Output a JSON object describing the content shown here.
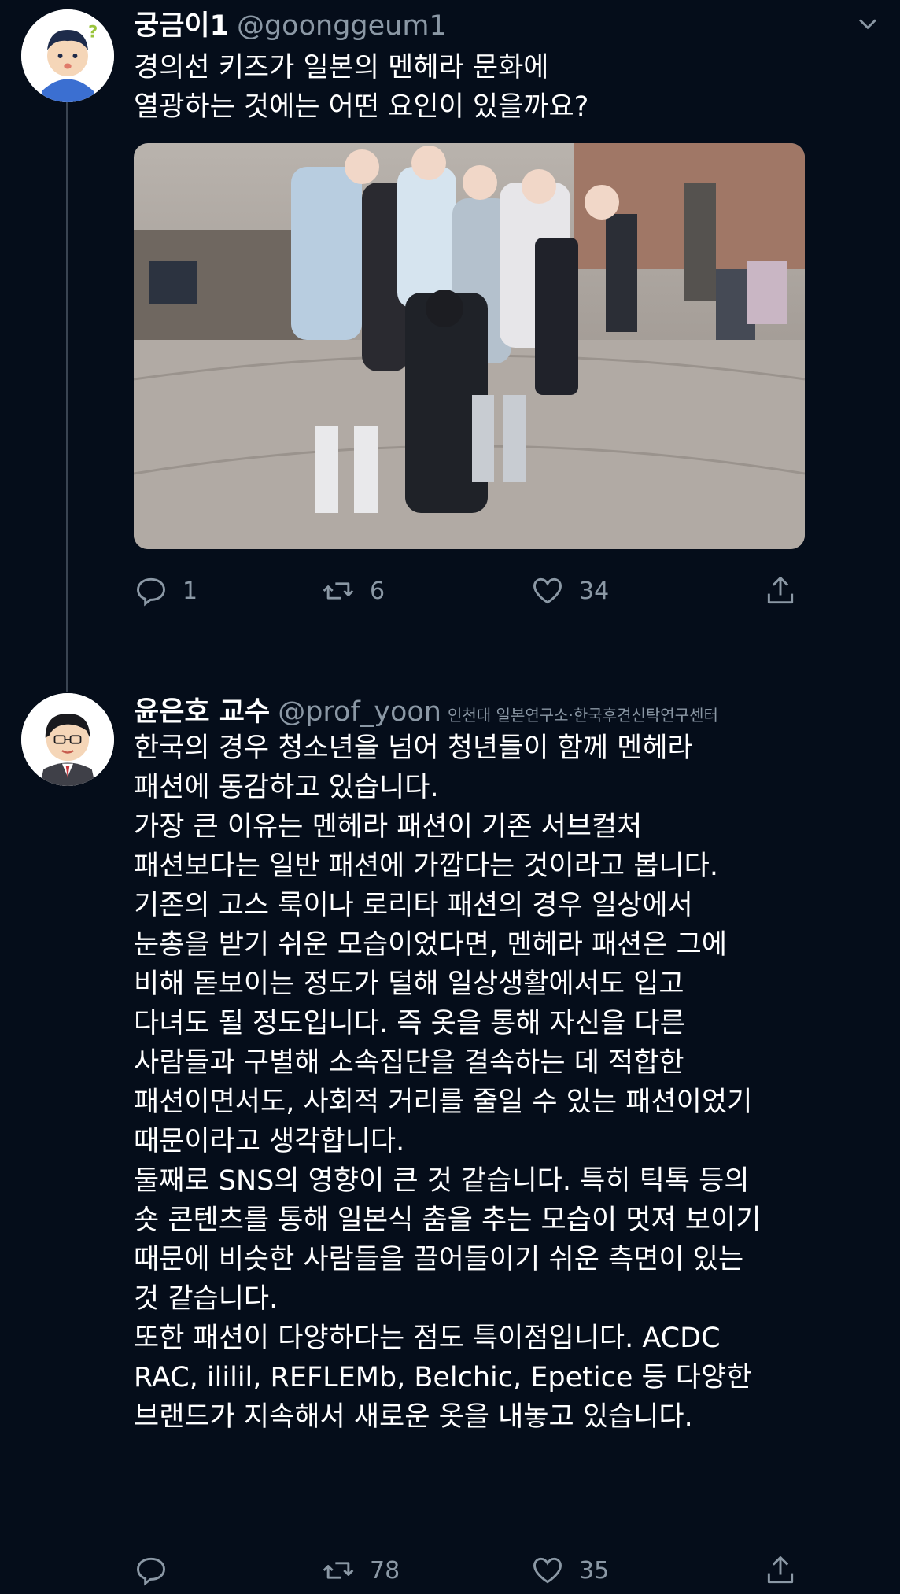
{
  "tweet1": {
    "name": "궁금이1",
    "handle": "@goonggeum1",
    "text": "경의선 키즈가 일본의 멘헤라 문화에\n열광하는 것에는 어떤 요인이 있을까요?",
    "stats": {
      "replies": "1",
      "retweets": "6",
      "likes": "34"
    }
  },
  "tweet2": {
    "name": "윤은호 교수",
    "handle": "@prof_yoon",
    "affiliation": "인천대 일본연구소·한국후견신탁연구센터",
    "text": "한국의 경우 청소년을 넘어 청년들이 함께 멘헤라\n패션에 동감하고 있습니다.\n가장 큰 이유는 멘헤라 패션이 기존 서브컬처\n패션보다는 일반 패션에 가깝다는 것이라고 봅니다.\n기존의 고스 룩이나 로리타 패션의 경우 일상에서\n눈총을 받기 쉬운 모습이었다면, 멘헤라 패션은 그에\n비해 돋보이는 정도가 덜해 일상생활에서도 입고\n다녀도 될 정도입니다. 즉 옷을 통해 자신을 다른\n사람들과 구별해 소속집단을 결속하는 데 적합한\n패션이면서도, 사회적 거리를 줄일 수 있는 패션이었기\n때문이라고 생각합니다.\n둘째로 SNS의 영향이 큰 것 같습니다. 특히 틱톡 등의\n숏 콘텐츠를 통해 일본식 춤을 추는 모습이 멋져 보이기\n때문에 비슷한 사람들을 끌어들이기 쉬운 측면이 있는\n것 같습니다.\n또한 패션이 다양하다는 점도 특이점입니다. ACDC\nRAC, ililil, REFLEMb, Belchic, Epetice 등 다양한\n브랜드가 지속해서 새로운 옷을 내놓고 있습니다.",
    "stats": {
      "replies": "",
      "retweets": "78",
      "likes": "35"
    }
  },
  "icons": {
    "reply": "reply-icon",
    "retweet": "retweet-icon",
    "like": "heart-icon",
    "share": "share-icon",
    "more": "chevron-down-icon"
  },
  "colors": {
    "background": "#050d1a",
    "muted": "#8b98a5",
    "thread_line": "#3a4452"
  }
}
